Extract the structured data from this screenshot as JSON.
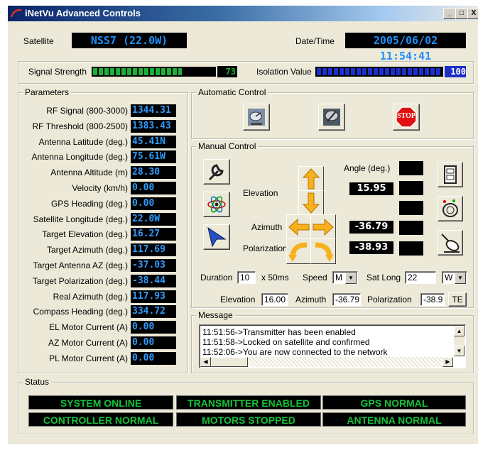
{
  "window": {
    "title": "iNetVu Advanced Controls",
    "controls": [
      "_",
      "□",
      "X"
    ]
  },
  "header": {
    "satellite_label": "Satellite",
    "satellite_value": "NSS7 (22.0W)",
    "datetime_label": "Date/Time",
    "datetime_value": "2005/06/02 11:54:41"
  },
  "meters": {
    "signal_label": "Signal Strength",
    "signal_value": "73",
    "signal_fraction": 0.73,
    "isolation_label": "Isolation Value",
    "isolation_value": "100",
    "isolation_fraction": 1.0
  },
  "parameters": {
    "title": "Parameters",
    "rows": [
      {
        "label": "RF Signal (800-3000)",
        "value": "1344.31"
      },
      {
        "label": "RF Threshold (800-2500)",
        "value": "1383.43"
      },
      {
        "label": "Antenna Latitude (deg.)",
        "value": "45.41N"
      },
      {
        "label": "Antenna Longitude (deg.)",
        "value": "75.61W"
      },
      {
        "label": "Antenna Altitude (m)",
        "value": "28.30"
      },
      {
        "label": "Velocity (km/h)",
        "value": "0.00"
      },
      {
        "label": "GPS Heading (deg.)",
        "value": "0.00"
      },
      {
        "label": "Satellite Longitude (deg.)",
        "value": "22.0W"
      },
      {
        "label": "Target Elevation (deg.)",
        "value": "16.27"
      },
      {
        "label": "Target Azimuth (deg.)",
        "value": "117.69"
      },
      {
        "label": "Target Antenna AZ (deg.)",
        "value": "-37.03"
      },
      {
        "label": "Target Polarization (deg.)",
        "value": "-38.44"
      },
      {
        "label": "Real Azimuth (deg.)",
        "value": "117.93"
      },
      {
        "label": "Compass Heading (deg.)",
        "value": "334.72"
      },
      {
        "label": "EL Motor Current (A)",
        "value": "0.00"
      },
      {
        "label": "AZ Motor Current (A)",
        "value": "0.00"
      },
      {
        "label": "PL Motor Current (A)",
        "value": "0.00"
      }
    ]
  },
  "automatic": {
    "title": "Automatic Control",
    "stop_label": "STOP",
    "icons": [
      "satellite-dish-icon",
      "wrench-dish-icon",
      "stop-sign-icon"
    ]
  },
  "manual": {
    "title": "Manual Control",
    "angle_label": "Angle (deg.)",
    "elevation_label": "Elevation",
    "elevation_value": "15.95",
    "azimuth_label": "Azimuth",
    "azimuth_value": "-36.79",
    "polarization_label": "Polarization",
    "polarization_value": "-38.93",
    "duration_label": "Duration",
    "duration_value": "10",
    "duration_unit": "x 50ms",
    "speed_label": "Speed",
    "speed_value": "M",
    "satlong_label": "Sat Long",
    "satlong_value": "22",
    "satlong_dir": "W",
    "elev_field_label": "Elevation",
    "elev_field_value": "16.00",
    "az_field_label": "Azimuth",
    "az_field_value": "-36.79",
    "pol_field_label": "Polarization",
    "pol_field_value": "-38.9",
    "te_label": "TE"
  },
  "message": {
    "title": "Message",
    "lines": [
      "11:51:56->Transmitter has been enabled",
      "11:51:58->Locked on satellite and confirmed",
      "11:52:06->You are now connected to the network"
    ]
  },
  "status": {
    "title": "Status",
    "cells": [
      "SYSTEM ONLINE",
      "TRANSMITTER ENABLED",
      "GPS NORMAL",
      "CONTROLLER NORMAL",
      "MOTORS STOPPED",
      "ANTENNA NORMAL"
    ]
  },
  "colors": {
    "lcd_text": "#2e9bff",
    "status_green": "#16c23a",
    "signal_green": "#1db03a",
    "isolation_blue": "#1c2fc8"
  }
}
